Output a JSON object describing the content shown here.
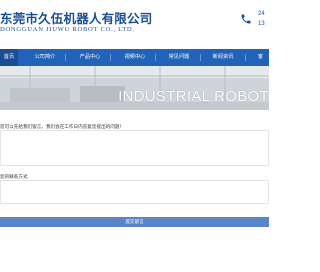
{
  "header": {
    "logo_cn": "东莞市久伍机器人有限公司",
    "logo_en": "DONGGUAN JIUWU ROBOT CO., LTD.",
    "phone_line1": "24",
    "phone_line2": "13",
    "phone_icon": "phone-icon"
  },
  "nav": {
    "items": [
      {
        "label": "首页"
      },
      {
        "label": "公司简介"
      },
      {
        "label": "产品中心"
      },
      {
        "label": "视频中心"
      },
      {
        "label": "常见问题"
      },
      {
        "label": "新闻资讯"
      },
      {
        "label": "客"
      }
    ],
    "active_index": 0
  },
  "banner": {
    "text": "INDUSTRIAL ROBOT"
  },
  "form": {
    "question_label": "您可以先给我们留言，我们会在工作日内答复您提出的问题！",
    "question_value": "",
    "contact_label": "您的联系方式",
    "contact_value": "",
    "submit_label": "提交留言"
  },
  "colors": {
    "brand": "#1a4e94",
    "nav": "#2063b8",
    "button": "#5a86c9"
  }
}
